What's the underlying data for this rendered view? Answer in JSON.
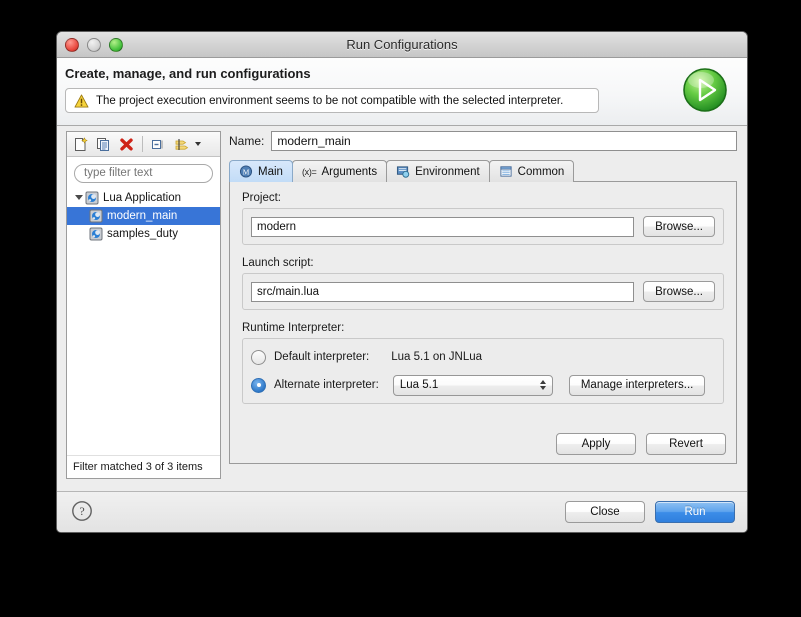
{
  "window": {
    "title": "Run Configurations",
    "traffic_lights": [
      "close",
      "minimize",
      "zoom"
    ]
  },
  "header": {
    "heading": "Create, manage, and run configurations",
    "message": "The project execution environment seems to be not compatible with the selected interpreter.",
    "message_icon": "warning-icon",
    "run_badge_icon": "run-play-icon"
  },
  "sidebar": {
    "toolbar": [
      {
        "name": "new-configuration-icon",
        "tip": "New launch configuration"
      },
      {
        "name": "duplicate-configuration-icon",
        "tip": "Duplicate"
      },
      {
        "name": "delete-configuration-icon",
        "tip": "Delete"
      },
      {
        "name": "collapse-all-icon",
        "tip": "Collapse All"
      },
      {
        "name": "filter-configurations-icon",
        "tip": "Filter"
      }
    ],
    "filter_placeholder": "type filter text",
    "filter_value": "",
    "tree": [
      {
        "label": "Lua Application",
        "icon": "lua-application-icon",
        "level": 0,
        "expanded": true,
        "selected": false
      },
      {
        "label": "modern_main",
        "icon": "lua-config-icon",
        "level": 1,
        "expanded": false,
        "selected": true
      },
      {
        "label": "samples_duty",
        "icon": "lua-config-icon",
        "level": 1,
        "expanded": false,
        "selected": false
      }
    ],
    "status": "Filter matched 3 of 3 items"
  },
  "main": {
    "name_label": "Name:",
    "name_value": "modern_main",
    "tabs": [
      {
        "label": "Main",
        "icon": "main-tab-icon",
        "active": true
      },
      {
        "label": "Arguments",
        "icon": "arguments-tab-icon",
        "active": false
      },
      {
        "label": "Environment",
        "icon": "environment-tab-icon",
        "active": false
      },
      {
        "label": "Common",
        "icon": "common-tab-icon",
        "active": false
      }
    ],
    "project": {
      "label": "Project:",
      "value": "modern",
      "browse_label": "Browse..."
    },
    "launch_script": {
      "label": "Launch script:",
      "value": "src/main.lua",
      "browse_label": "Browse..."
    },
    "runtime_interpreter": {
      "label": "Runtime Interpreter:",
      "default_label": "Default interpreter:",
      "default_value": "Lua 5.1 on JNLua",
      "default_selected": false,
      "alternate_label": "Alternate interpreter:",
      "alternate_selected": true,
      "alternate_value": "Lua 5.1",
      "manage_label": "Manage interpreters..."
    },
    "apply_label": "Apply",
    "revert_label": "Revert"
  },
  "footer": {
    "help_icon": "help-icon",
    "close_label": "Close",
    "run_label": "Run"
  },
  "colors": {
    "selection": "#3875d7",
    "primary_button": "#3c8de8",
    "active_tab": "#c2dcf7",
    "warning": "#e8a317",
    "run_green": "#44c13c"
  }
}
